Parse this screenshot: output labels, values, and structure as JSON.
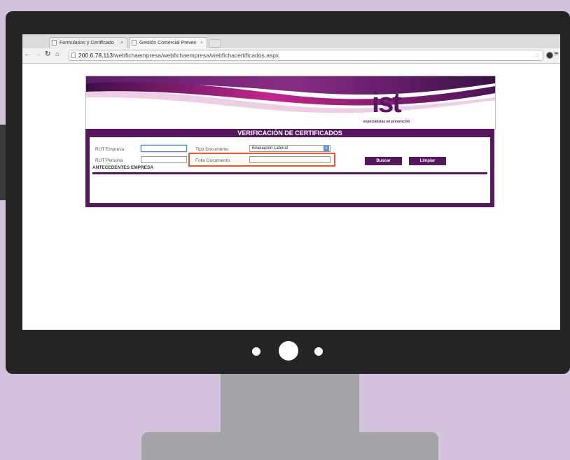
{
  "browser": {
    "tabs": [
      {
        "label": "Formularios y Certificado"
      },
      {
        "label": "Gestión Comercial Preven"
      }
    ],
    "url_host": "200.6.78.113",
    "url_path": "/webfichaempresa/webfichaempresa/webfichacertificados.aspx"
  },
  "brand": {
    "logo_text": "ist",
    "tagline": "especialistas en prevención",
    "accent_color": "#55175e",
    "magenta": "#c2268d"
  },
  "form": {
    "title": "VERIFICACIÓN DE CERTIFICADOS",
    "rut_empresa_label": "RUT Empresa",
    "rut_persona_label": "RUT Persona",
    "tipo_documento_label": "Tipo Documento",
    "tipo_documento_value": "Evaluación Laboral",
    "folio_label": "Folio Documento",
    "buscar_label": "Buscar",
    "limpiar_label": "Limpiar",
    "section_title": "ANTECEDENTES EMPRESA"
  },
  "highlight_color": "#e8562a"
}
